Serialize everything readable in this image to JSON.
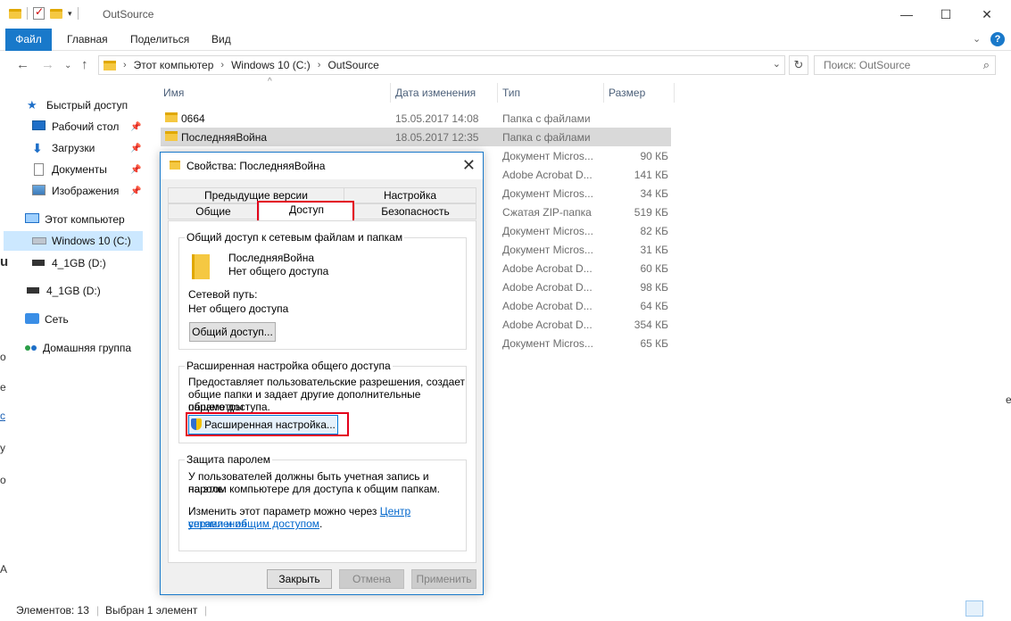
{
  "window": {
    "title": "OutSource",
    "minimize": "—",
    "maximize": "☐",
    "close": "✕"
  },
  "ribbon": {
    "tabs": [
      "Файл",
      "Главная",
      "Поделиться",
      "Вид"
    ],
    "help": "?",
    "expand": "⌄"
  },
  "address": {
    "crumbs": [
      "Этот компьютер",
      "Windows 10 (C:)",
      "OutSource"
    ],
    "separator": "›",
    "search_placeholder": "Поиск: OutSource"
  },
  "nav": {
    "quick_access": "Быстрый доступ",
    "desktop": "Рабочий стол",
    "downloads": "Загрузки",
    "documents": "Документы",
    "images": "Изображения",
    "this_pc": "Этот компьютер",
    "c_drive": "Windows 10 (C:)",
    "d_drive_child": "4_1GB (D:)",
    "d_drive": "4_1GB (D:)",
    "network": "Сеть",
    "homegroup": "Домашняя группа"
  },
  "columns": {
    "name": "Имя",
    "date": "Дата изменения",
    "type": "Тип",
    "size": "Размер"
  },
  "files": [
    {
      "name": "0664",
      "date": "15.05.2017 14:08",
      "type": "Папка с файлами",
      "size": ""
    },
    {
      "name": "ПоследняяВойна",
      "date": "18.05.2017 12:35",
      "type": "Папка с файлами",
      "size": ""
    },
    {
      "name": "",
      "date": "",
      "type": "Документ Micros...",
      "size": "90 КБ"
    },
    {
      "name": "",
      "date": "",
      "type": "Adobe Acrobat D...",
      "size": "141 КБ"
    },
    {
      "name": "",
      "date": "",
      "type": "Документ Micros...",
      "size": "34 КБ"
    },
    {
      "name": "",
      "date": "",
      "type": "Сжатая ZIP-папка",
      "size": "519 КБ"
    },
    {
      "name": "",
      "date": "",
      "type": "Документ Micros...",
      "size": "82 КБ"
    },
    {
      "name": "",
      "date": "",
      "type": "Документ Micros...",
      "size": "31 КБ"
    },
    {
      "name": "",
      "date": "",
      "type": "Adobe Acrobat D...",
      "size": "60 КБ"
    },
    {
      "name": "",
      "date": "",
      "type": "Adobe Acrobat D...",
      "size": "98 КБ"
    },
    {
      "name": "",
      "date": "",
      "type": "Adobe Acrobat D...",
      "size": "64 КБ"
    },
    {
      "name": "",
      "date": "",
      "type": "Adobe Acrobat D...",
      "size": "354 КБ"
    },
    {
      "name": "",
      "date": "",
      "type": "Документ Micros...",
      "size": "65 КБ"
    }
  ],
  "status": {
    "count": "Элементов: 13",
    "selected": "Выбран 1 элемент"
  },
  "dialog": {
    "title": "Свойства: ПоследняяВойна",
    "tabs": {
      "prev_versions": "Предыдущие версии",
      "settings": "Настройка",
      "general": "Общие",
      "access": "Доступ",
      "security": "Безопасность"
    },
    "sharing": {
      "group_label": "Общий доступ к сетевым файлам и папкам",
      "folder_name": "ПоследняяВойна",
      "folder_state": "Нет общего доступа",
      "path_label": "Сетевой путь:",
      "path_value": "Нет общего доступа",
      "share_button": "Общий доступ..."
    },
    "advanced": {
      "group_label": "Расширенная настройка общего доступа",
      "line1": "Предоставляет пользовательские разрешения, создает",
      "line2": "общие папки и задает другие дополнительные параметры",
      "line3": "общего доступа.",
      "button": "Расширенная настройка..."
    },
    "password": {
      "group_label": "Защита паролем",
      "line1": "У пользователей должны быть учетная запись и пароль",
      "line2": "на этом компьютере для доступа к общим папкам.",
      "line3_prefix": "Изменить этот параметр можно через",
      "link1": "Центр управления",
      "link2": "сетями и общим доступом",
      "line4_suffix": "."
    },
    "buttons": {
      "close": "Закрыть",
      "cancel": "Отмена",
      "apply": "Применить"
    }
  },
  "edge_fragments": {
    "left_u": "u",
    "left_o1": "o",
    "left_e": "е",
    "left_c": "с",
    "left_u2": "у",
    "left_o2": "о",
    "left_d": "А",
    "right_a": "е"
  },
  "colors": {
    "accent": "#1979ca",
    "selection": "#cce8ff",
    "highlight_box": "#e3001b"
  }
}
